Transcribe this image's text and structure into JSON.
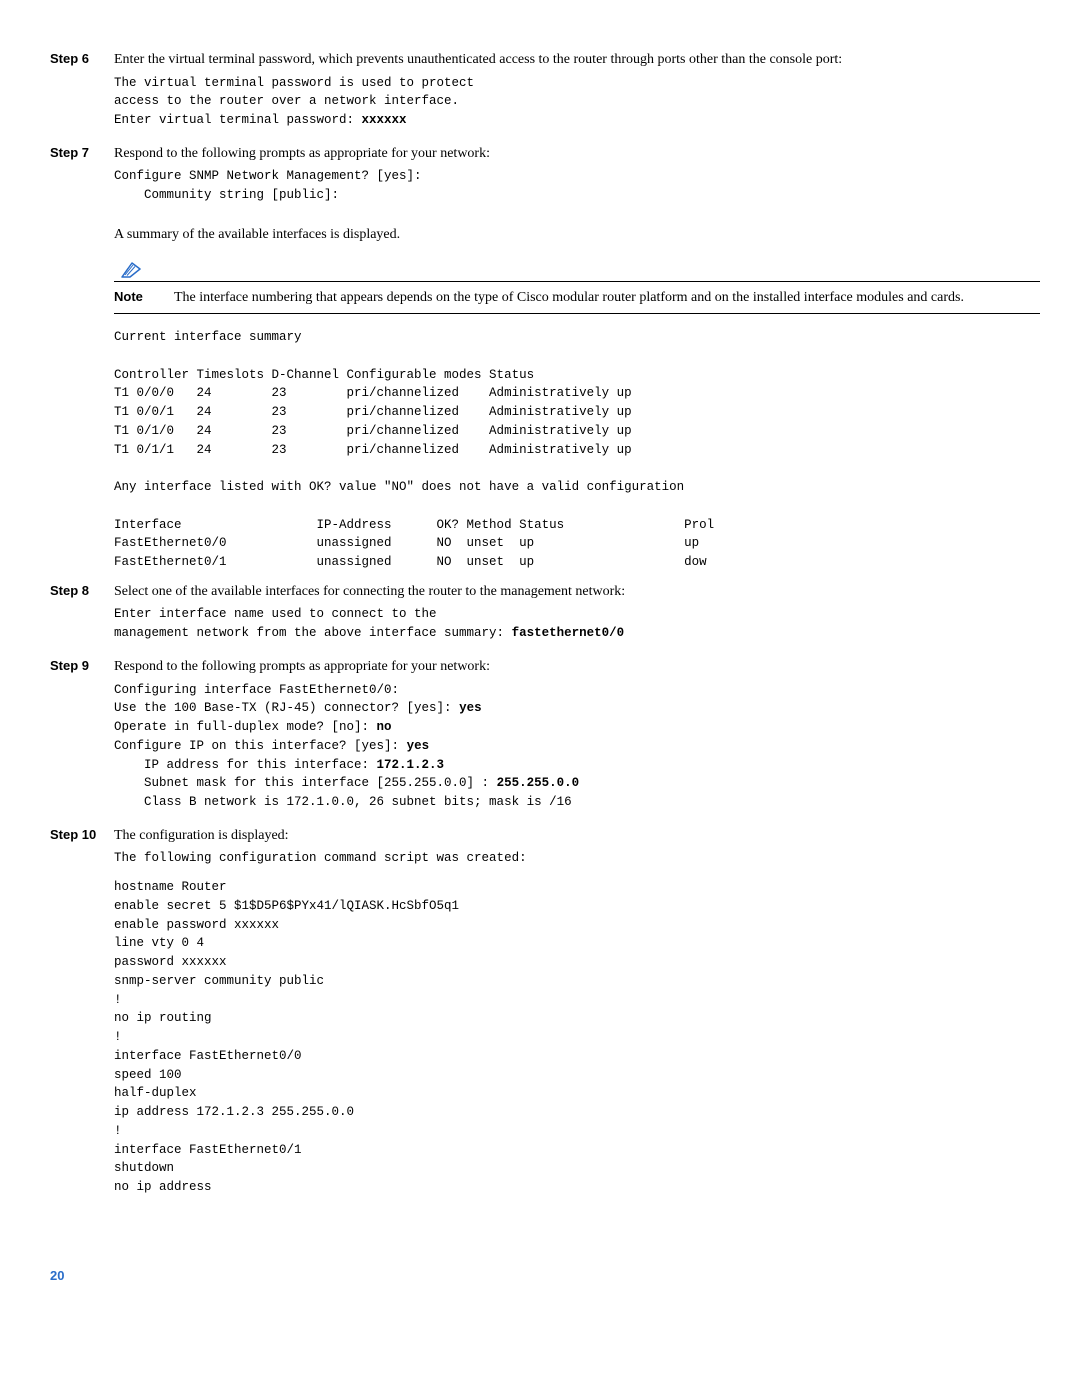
{
  "step6": {
    "label": "Step 6",
    "text": "Enter the virtual terminal password, which prevents unauthenticated access to the router through ports other than the console port:",
    "code_l1": "The virtual terminal password is used to protect",
    "code_l2": "access to the router over a network interface.",
    "code_l3_pre": "Enter virtual terminal password: ",
    "code_l3_b": "xxxxxx"
  },
  "step7": {
    "label": "Step 7",
    "text": "Respond to the following prompts as appropriate for your network:",
    "code_l1": "Configure SNMP Network Management? [yes]:",
    "code_l2": "    Community string [public]:",
    "summary_line": "A summary of the available interfaces is displayed."
  },
  "note": {
    "label": "Note",
    "text": "The interface numbering that appears depends on the type of Cisco modular router platform and on the installed interface modules and cards."
  },
  "summary_block": "Current interface summary\n\nController Timeslots D-Channel Configurable modes Status\nT1 0/0/0   24        23        pri/channelized    Administratively up\nT1 0/0/1   24        23        pri/channelized    Administratively up\nT1 0/1/0   24        23        pri/channelized    Administratively up\nT1 0/1/1   24        23        pri/channelized    Administratively up\n\nAny interface listed with OK? value \"NO\" does not have a valid configuration\n\nInterface                  IP-Address      OK? Method Status                Prol\nFastEthernet0/0            unassigned      NO  unset  up                    up \nFastEthernet0/1            unassigned      NO  unset  up                    dow",
  "step8": {
    "label": "Step 8",
    "text": "Select one of the available interfaces for connecting the router to the management network:",
    "code_l1": "Enter interface name used to connect to the",
    "code_l2_pre": "management network from the above interface summary: ",
    "code_l2_b": "fastethernet0/0"
  },
  "step9": {
    "label": "Step 9",
    "text": "Respond to the following prompts as appropriate for your network:",
    "code_l1": "Configuring interface FastEthernet0/0:",
    "code_l2_pre": "Use the 100 Base-TX (RJ-45) connector? [yes]: ",
    "code_l2_b": "yes",
    "code_l3_pre": "Operate in full-duplex mode? [no]: ",
    "code_l3_b": "no",
    "code_l4_pre": "Configure IP on this interface? [yes]: ",
    "code_l4_b": "yes",
    "code_l5_pre": "    IP address for this interface: ",
    "code_l5_b": "172.1.2.3",
    "code_l6_pre": "    Subnet mask for this interface [255.255.0.0] : ",
    "code_l6_b": "255.255.0.0",
    "code_l7": "    Class B network is 172.1.0.0, 26 subnet bits; mask is /16"
  },
  "step10": {
    "label": "Step 10",
    "text": "The configuration is displayed:",
    "code_intro": "The following configuration command script was created:",
    "code_block": "hostname Router\nenable secret 5 $1$D5P6$PYx41/lQIASK.HcSbfO5q1\nenable password xxxxxx\nline vty 0 4\npassword xxxxxx\nsnmp-server community public\n!\nno ip routing\n!\ninterface FastEthernet0/0\nspeed 100\nhalf-duplex\nip address 172.1.2.3 255.255.0.0\n!\ninterface FastEthernet0/1\nshutdown\nno ip address"
  },
  "page_number": "20"
}
